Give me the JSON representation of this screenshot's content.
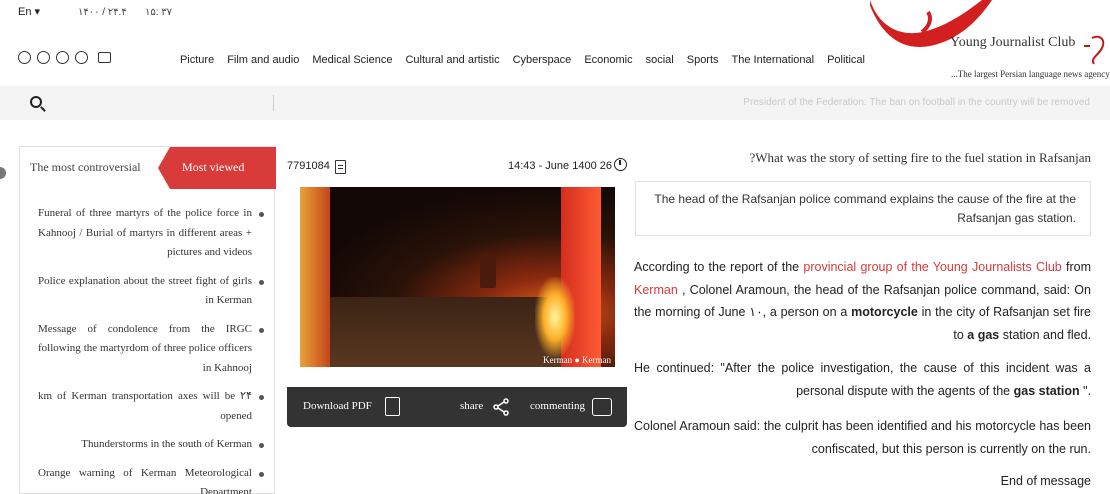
{
  "header": {
    "lang": "En",
    "date": "۱۴۰۰ / ۲۴.۴",
    "time": "۱۵: ۳۷",
    "nav": [
      "Political",
      "The International",
      "Sports",
      "social",
      "Economic",
      "Cyberspace",
      "Cultural and artistic",
      "Medical Science",
      "Film and audio",
      "Picture"
    ],
    "icons": [
      "podcast-icon",
      "play-icon",
      "emoji-icon",
      "list-icon",
      "tv-icon"
    ]
  },
  "logo": {
    "title": "Young Journalist Club",
    "subtitle": "The largest Persian language news agency",
    "brand_color": "#d21f1f"
  },
  "search": {
    "ticker": "President of the Federation: The ban on football in the country will be removed"
  },
  "sidebar": {
    "tab_controversial": "The most controversial",
    "tab_viewed": "Most viewed",
    "items": [
      "Funeral of three martyrs of the police force in Kahnooj / Burial of martyrs in different areas + pictures and videos",
      "Police explanation about the street fight of girls in Kerman",
      "Message of condolence from the IRGC following the martyrdom of three police officers in Kahnooj",
      "km of Kerman transportation axes will be ۲۴ opened",
      "Thunderstorms in the south of Kerman",
      "Orange warning of Kerman Meteorological Department"
    ]
  },
  "article": {
    "id": "7791084",
    "timestamp": "14:43 - June 1400 26",
    "photo_watermark": "Kerman  ●  Kerman",
    "download_pdf": "Download PDF",
    "share": "share",
    "commenting": "commenting",
    "headline": "?What was the story of setting fire to the fuel station in Rafsanjan",
    "lead": "The head of the Rafsanjan police command explains the cause of the fire at the Rafsanjan gas station.",
    "p1_a": "According to the report of the ",
    "p1_link1": "provincial group of the Young Journalists Club",
    "p1_b": " from ",
    "p1_link2": "Kerman",
    "p1_c": " ,  Colonel Aramoun, the head of the Rafsanjan police command, said: On the morning of June ۱۰, a person on a ",
    "p1_bold1": "motorcycle",
    "p1_d": " in the city of Rafsanjan set fire to ",
    "p1_bold2": "a gas",
    "p1_e": " station and fled.",
    "p2_a": "He continued: \"After the police investigation, the cause of this incident was a personal dispute with the agents of the ",
    "p2_bold": "gas station",
    "p2_b": " \".",
    "p3": "Colonel Aramoun said: the culprit has been identified and his motorcycle has been confiscated, but this person is currently on the run.",
    "p4": "End of message"
  }
}
